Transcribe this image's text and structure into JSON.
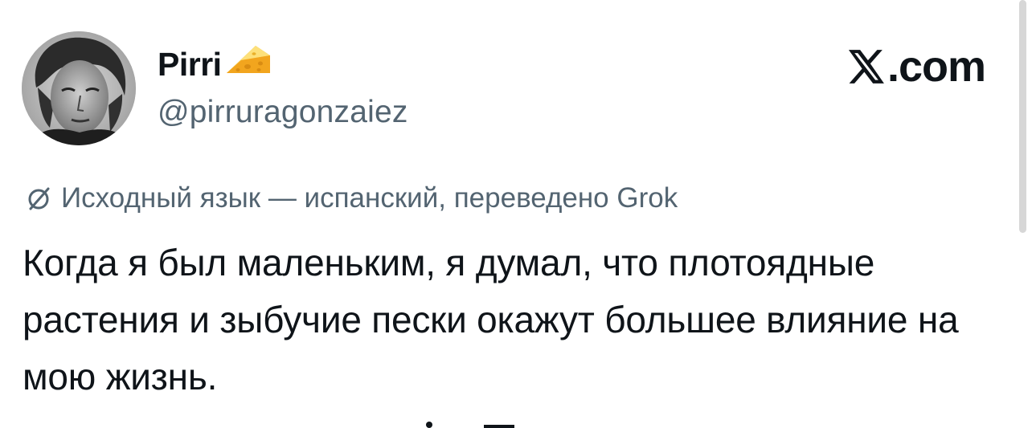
{
  "author": {
    "display_name": "Pirri",
    "emoji_icon": "cheese-emoji-icon",
    "handle": "@pirruragonzaiez",
    "avatar_icon": "profile-photo-avatar"
  },
  "brand": {
    "logo_icon": "x-logo-icon",
    "label": ".com"
  },
  "translation": {
    "icon": "translate-icon",
    "note": "Исходный язык — испанский, переведено Grok"
  },
  "tweet": {
    "text": "Когда я был маленьким, я думал, что плотоядные растения и зыбучие пески окажут большее влияние на мою жизнь."
  },
  "colors": {
    "text_primary": "#0f1419",
    "text_secondary": "#536471",
    "background": "#ffffff"
  }
}
